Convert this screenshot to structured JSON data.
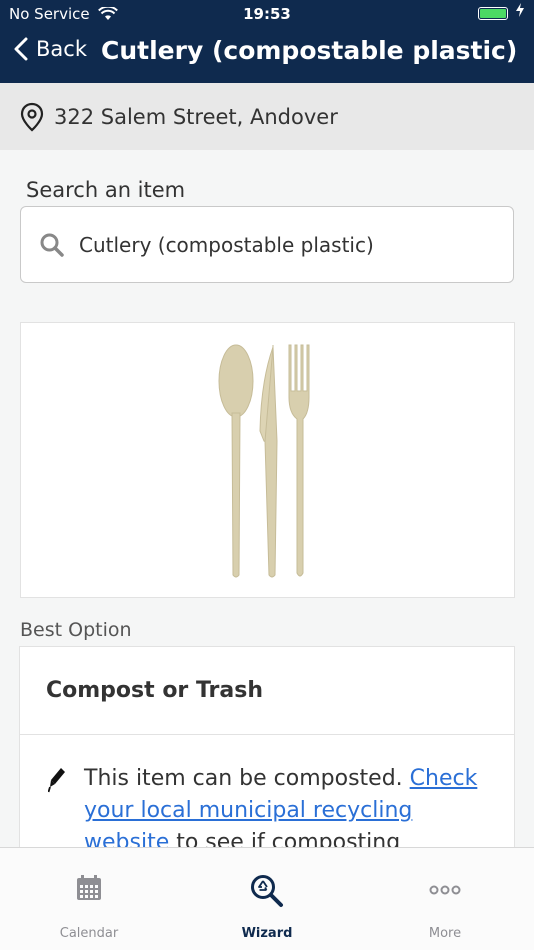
{
  "status_bar": {
    "carrier": "No Service",
    "time": "19:53"
  },
  "nav": {
    "back_label": "Back",
    "title": "Cutlery (compostable plastic)"
  },
  "location": {
    "address": "322 Salem Street, Andover"
  },
  "search": {
    "label": "Search an item",
    "value": "Cutlery (compostable plastic)"
  },
  "best_option": {
    "section_label": "Best Option",
    "title": "Compost or Trash",
    "text_before": "This item can be composted. ",
    "link_text": "Check your local municipal recycling website",
    "text_after": " to see if composting services"
  },
  "tabs": [
    {
      "label": "Calendar",
      "icon": "calendar-icon"
    },
    {
      "label": "Wizard",
      "icon": "recycle-search-icon"
    },
    {
      "label": "More",
      "icon": "more-icon"
    }
  ],
  "colors": {
    "nav_bg": "#0f2a4e",
    "link": "#2a6fd6",
    "battery": "#4cd964"
  }
}
